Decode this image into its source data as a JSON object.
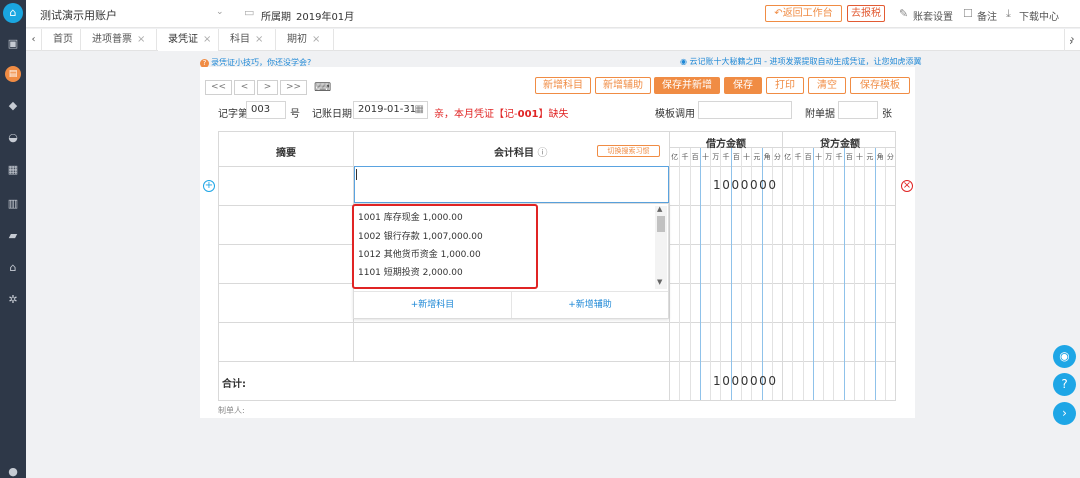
{
  "header": {
    "account_name": "测试演示用账户",
    "period_label": "所属期",
    "period_value": "2019年01月",
    "back_button": "返回工作台",
    "tax_button": "去报税",
    "account_settings": "账套设置",
    "notes": "备注",
    "download_center": "下载中心"
  },
  "tabs": [
    {
      "label": "首页"
    },
    {
      "label": "进项普票"
    },
    {
      "label": "录凭证"
    },
    {
      "label": "科目"
    },
    {
      "label": "期初"
    }
  ],
  "tips": {
    "left": "录凭证小技巧，你还没学会?",
    "right": "云记账十大秘籍之四 - 进项发票提取自动生成凭证，让您如虎添翼"
  },
  "nav": {
    "first": "<<",
    "prev": "<",
    "next": ">",
    "last": ">>"
  },
  "actions": {
    "new_subject": "新增科目",
    "new_aux": "新增辅助",
    "save_and_new": "保存并新增",
    "save": "保存",
    "print": "打印",
    "clear": "清空",
    "save_template": "保存模板"
  },
  "voucher": {
    "word_label": "记字第",
    "number": "003",
    "number_suffix": "号",
    "date_label": "记账日期",
    "date": "2019-01-31",
    "warning_prefix": "亲，本月凭证【记-",
    "warning_number": "001",
    "warning_suffix": "】缺失",
    "template_label": "模板调用",
    "attach_label": "附单据",
    "attach_unit": "张"
  },
  "table": {
    "col_summary": "摘要",
    "col_subject": "会计科目",
    "switch_button": "切换搜索习惯",
    "debit_header": "借方金额",
    "credit_header": "贷方金额",
    "digit_units": [
      "亿",
      "千",
      "百",
      "十",
      "万",
      "千",
      "百",
      "十",
      "元",
      "角",
      "分"
    ],
    "row1_debit": "1000000",
    "total_label": "合计:",
    "total_debit": "1000000",
    "preparer_label": "制单人:"
  },
  "dropdown": {
    "items": [
      "1001 库存现金    1,000.00",
      "1002 银行存款    1,007,000.00",
      "1012 其他货币资金    1,000.00",
      "1101 短期投资    2,000.00"
    ],
    "add_subject": "+新增科目",
    "add_aux": "+新增辅助"
  },
  "colors": {
    "accent": "#f08c44",
    "sidebar": "#2e3848",
    "highlight": "#e02424",
    "link": "#1ea6e6"
  }
}
